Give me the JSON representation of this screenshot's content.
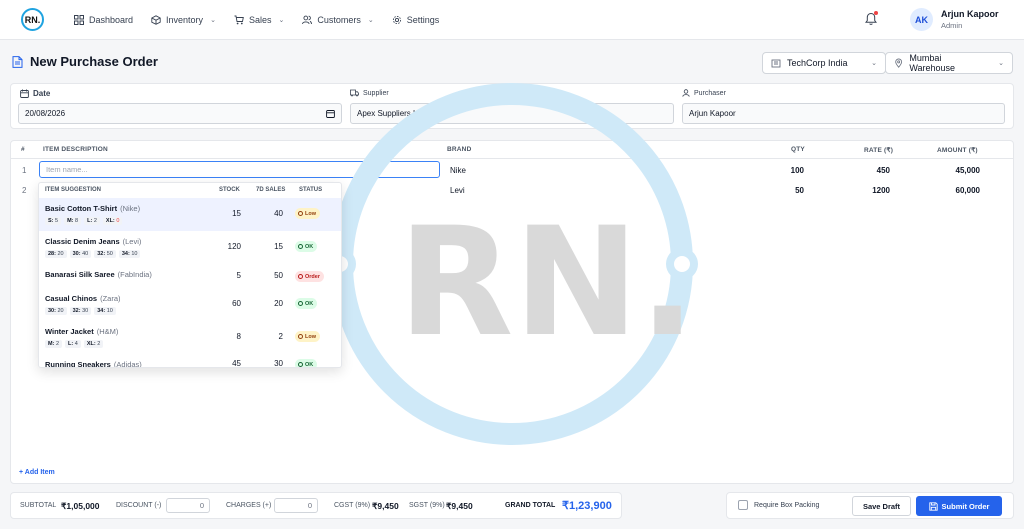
{
  "brand": {
    "logo_text": "RN.",
    "watermark_text": "RN."
  },
  "nav": {
    "items": [
      {
        "label": "Dashboard",
        "icon": "grid-icon",
        "dropdown": false
      },
      {
        "label": "Inventory",
        "icon": "cube-icon",
        "dropdown": true
      },
      {
        "label": "Sales",
        "icon": "cart-icon",
        "dropdown": true
      },
      {
        "label": "Customers",
        "icon": "users-icon",
        "dropdown": true
      },
      {
        "label": "Settings",
        "icon": "gear-icon",
        "dropdown": false
      }
    ]
  },
  "user": {
    "initials": "AK",
    "name": "Arjun Kapoor",
    "role": "Admin"
  },
  "page": {
    "title": "New Purchase Order",
    "company": "TechCorp India",
    "warehouse": "Mumbai Warehouse"
  },
  "form": {
    "date_label": "Date",
    "date_value": "20/08/2026",
    "supplier_label": "Supplier",
    "supplier_value": "Apex Suppliers Ltd.",
    "purchaser_label": "Purchaser",
    "purchaser_value": "Arjun Kapoor"
  },
  "table": {
    "headers": {
      "num": "#",
      "item": "ITEM DESCRIPTION",
      "brand": "BRAND",
      "qty": "QTY",
      "rate": "RATE (₹)",
      "amount": "AMOUNT (₹)"
    },
    "item_placeholder": "Item name...",
    "rows": [
      {
        "num": "1",
        "brand": "Nike",
        "qty": "100",
        "rate": "450",
        "amount": "45,000"
      },
      {
        "num": "2",
        "brand": "Levi",
        "qty": "50",
        "rate": "1200",
        "amount": "60,000"
      }
    ],
    "add_item": "+ Add Item"
  },
  "suggestions": {
    "headers": {
      "item": "ITEM SUGGESTION",
      "stock": "STOCK",
      "sales": "7D SALES",
      "status": "STATUS"
    },
    "items": [
      {
        "name": "Basic Cotton T-Shirt",
        "brand": "(Nike)",
        "stock": "15",
        "sales": "40",
        "status": "Low",
        "status_type": "low",
        "sizes": [
          {
            "k": "S:",
            "v": "5"
          },
          {
            "k": "M:",
            "v": "8"
          },
          {
            "k": "L:",
            "v": "2"
          },
          {
            "k": "XL:",
            "v": "0"
          }
        ]
      },
      {
        "name": "Classic Denim Jeans",
        "brand": "(Levi)",
        "stock": "120",
        "sales": "15",
        "status": "OK",
        "status_type": "ok",
        "sizes": [
          {
            "k": "28:",
            "v": "20"
          },
          {
            "k": "30:",
            "v": "40"
          },
          {
            "k": "32:",
            "v": "50"
          },
          {
            "k": "34:",
            "v": "10"
          }
        ]
      },
      {
        "name": "Banarasi Silk Saree",
        "brand": "(FabIndia)",
        "stock": "5",
        "sales": "50",
        "status": "Order",
        "status_type": "order",
        "sizes": []
      },
      {
        "name": "Casual Chinos",
        "brand": "(Zara)",
        "stock": "60",
        "sales": "20",
        "status": "OK",
        "status_type": "ok",
        "sizes": [
          {
            "k": "30:",
            "v": "20"
          },
          {
            "k": "32:",
            "v": "30"
          },
          {
            "k": "34:",
            "v": "10"
          }
        ]
      },
      {
        "name": "Winter Jacket",
        "brand": "(H&M)",
        "stock": "8",
        "sales": "2",
        "status": "Low",
        "status_type": "low",
        "sizes": [
          {
            "k": "M:",
            "v": "2"
          },
          {
            "k": "L:",
            "v": "4"
          },
          {
            "k": "XL:",
            "v": "2"
          }
        ]
      },
      {
        "name": "Running Sneakers",
        "brand": "(Adidas)",
        "stock": "45",
        "sales": "30",
        "status": "OK",
        "status_type": "ok",
        "sizes": []
      }
    ]
  },
  "footer": {
    "subtotal_label": "SUBTOTAL",
    "subtotal_value": "₹1,05,000",
    "discount_label": "DISCOUNT (-)",
    "discount_value": "0",
    "charges_label": "CHARGES (+)",
    "charges_value": "0",
    "cgst_label": "CGST (9%)",
    "cgst_value": "₹9,450",
    "sgst_label": "SGST (9%)",
    "sgst_value": "₹9,450",
    "grand_label": "GRAND TOTAL",
    "grand_value": "₹1,23,900",
    "box_packing_label": "Require Box Packing",
    "save_draft": "Save Draft",
    "submit": "Submit Order"
  },
  "colors": {
    "accent": "#2563eb",
    "watermark": "#cfe9f8",
    "logo_ring": "#1fa3e0"
  }
}
